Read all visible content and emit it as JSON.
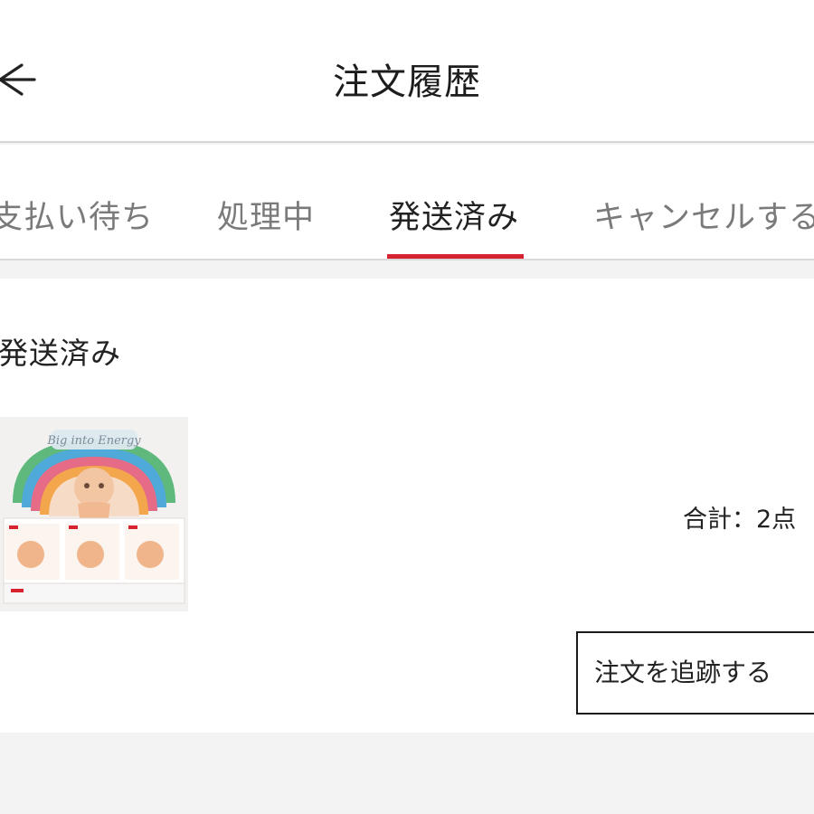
{
  "header": {
    "title": "注文履歴",
    "back_icon": "back-arrow-icon"
  },
  "tabs": [
    {
      "label": "支払い待ち",
      "active": false
    },
    {
      "label": "処理中",
      "active": false
    },
    {
      "label": "発送済み",
      "active": true
    },
    {
      "label": "キャンセルする",
      "active": false
    }
  ],
  "order": {
    "status": "発送済み",
    "product_image": {
      "alt": "product-thumbnail",
      "box_lettering": "Big into Energy"
    },
    "total_text": "合計：2点",
    "track_button": "注文を追跡する"
  },
  "colors": {
    "accent": "#d6232f",
    "background": "#f3f3f3"
  }
}
